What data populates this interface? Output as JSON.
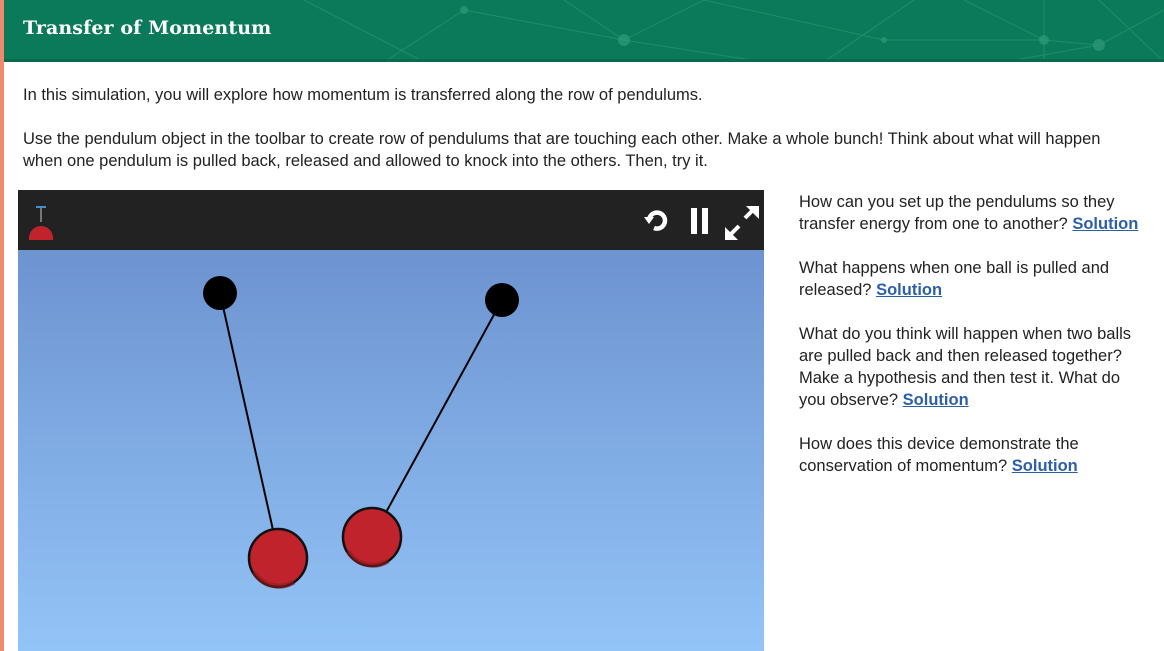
{
  "header": {
    "title": "Transfer of Momentum",
    "background": "#0a7a5a"
  },
  "intro": {
    "p1": "In this simulation, you will explore how momentum is transferred along the row of pendulums.",
    "p2": "Use the pendulum object in the toolbar to create row of pendulums that are touching each other. Make a whole bunch! Think about what will happen when one pendulum is pulled back, released and allowed to knock into the others. Then, try it."
  },
  "simulation": {
    "toolbar": {
      "tool_icon": "pendulum-tool-icon",
      "controls": [
        "reset-icon",
        "pause-icon",
        "fullscreen-icon"
      ]
    },
    "sky_top": "#6d93d0",
    "sky_bottom": "#93c4f7",
    "ball_color": "#c0232c"
  },
  "questions": [
    {
      "text": "How can you set up the pendulums so they transfer energy from one to another?",
      "link": "Solution"
    },
    {
      "text": "What happens when one ball is pulled and released?",
      "link": "Solution"
    },
    {
      "text": "What do you think will happen when two balls are pulled back and then released together? Make a hypothesis and then test it. What do you observe?",
      "link": "Solution"
    },
    {
      "text": "How does this device demonstrate the conservation of momentum?",
      "link": "Solution"
    }
  ]
}
